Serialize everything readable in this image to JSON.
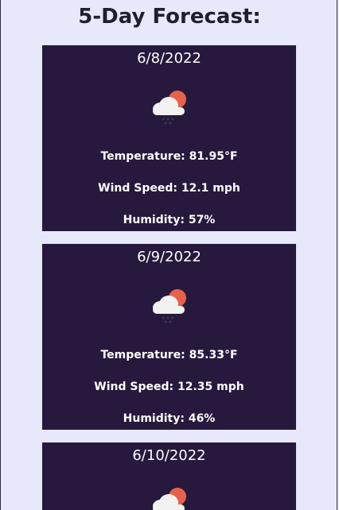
{
  "page": {
    "heading": "5-Day Forecast:"
  },
  "forecast": [
    {
      "date": "6/8/2022",
      "icon": "cloud-sun-rain-icon",
      "temperature": "Temperature: 81.95°F",
      "wind": "Wind Speed: 12.1 mph",
      "humidity": "Humidity: 57%"
    },
    {
      "date": "6/9/2022",
      "icon": "cloud-sun-rain-icon",
      "temperature": "Temperature: 85.33°F",
      "wind": "Wind Speed: 12.35 mph",
      "humidity": "Humidity: 46%"
    },
    {
      "date": "6/10/2022",
      "icon": "cloud-sun-rain-icon"
    }
  ],
  "colors": {
    "background": "#e8e8fb",
    "card": "#27193d",
    "sun": "#e8624a",
    "cloud": "#f2f2f2",
    "rain": "#3a3a55"
  }
}
